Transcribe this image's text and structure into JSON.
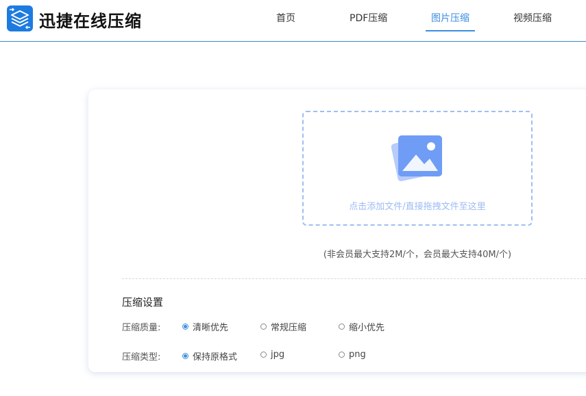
{
  "header": {
    "brand": "迅捷在线压缩",
    "logo_icon": "stacked-layers-icon",
    "nav": [
      {
        "label": "首页",
        "active": false
      },
      {
        "label": "PDF压缩",
        "active": false
      },
      {
        "label": "图片压缩",
        "active": true
      },
      {
        "label": "视频压缩",
        "active": false
      }
    ]
  },
  "upload": {
    "icon": "image-icon",
    "hint": "点击添加文件/直接拖拽文件至这里",
    "limit": "(非会员最大支持2M/个，会员最大支持40M/个)"
  },
  "settings": {
    "title": "压缩设置",
    "quality": {
      "label": "压缩质量:",
      "options": [
        "清晰优先",
        "常规压缩",
        "缩小优先"
      ],
      "selected": "清晰优先"
    },
    "type": {
      "label": "压缩类型:",
      "options": [
        "保持原格式",
        "jpg",
        "png"
      ],
      "selected": "保持原格式"
    }
  },
  "colors": {
    "accent": "#3a8de0",
    "dropzone_border": "#9fbdf5",
    "header_border": "#3d86c6"
  }
}
